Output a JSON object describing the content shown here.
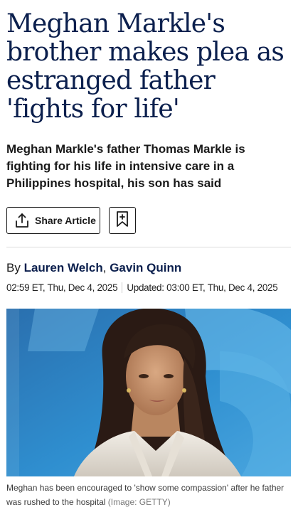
{
  "article": {
    "headline": "Meghan Markle's brother makes plea as estranged father 'fights for life'",
    "standfirst": "Meghan Markle's father Thomas Markle is fighting for his life in intensive care in a Philippines hospital, his son has said",
    "share_label": "Share Article",
    "byline_prefix": "By",
    "authors": [
      "Lauren Welch",
      "Gavin Quinn"
    ],
    "author_separator": ",",
    "published": "02:59 ET, Thu, Dec 4, 2025",
    "updated": "Updated: 03:00 ET, Thu, Dec 4, 2025",
    "image": {
      "caption": "Meghan has been encouraged to 'show some compassion' after he father was rushed to the hospital",
      "credit": "(Image: GETTY)"
    }
  },
  "colors": {
    "headline": "#0b1f4d",
    "author_link": "#0b1f4d",
    "image_background": "#2b7fc0"
  },
  "icons": {
    "share": "share-upload-icon",
    "bookmark": "bookmark-icon"
  }
}
